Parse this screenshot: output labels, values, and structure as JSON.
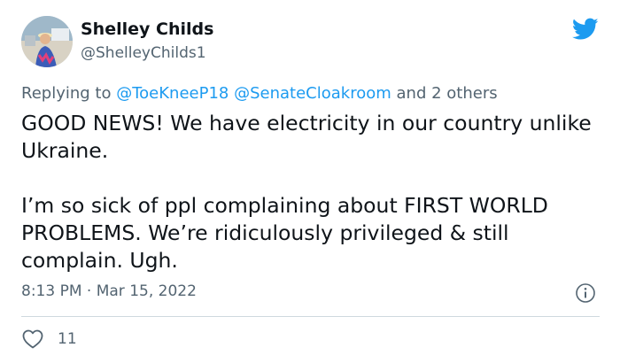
{
  "author": {
    "name": "Shelley Childs",
    "handle": "@ShelleyChilds1"
  },
  "reply": {
    "prefix": "Replying to",
    "mentions": [
      "@ToeKneeP18",
      "@SenateCloakroom"
    ],
    "suffix": "and 2 others"
  },
  "tweet": {
    "paragraphs": [
      "GOOD NEWS! We have electricity in our country unlike Ukraine.",
      "I’m so sick of ppl complaining about FIRST WORLD PROBLEMS. We’re ridiculously privileged & still complain. Ugh."
    ]
  },
  "meta": {
    "timestamp": "8:13 PM · Mar 15, 2022"
  },
  "stats": {
    "likes": "11"
  },
  "icons": {
    "brand": "twitter-bird-icon",
    "info": "info-icon",
    "like": "heart-icon"
  },
  "colors": {
    "brand": "#1d9bf0",
    "text": "#0f1419",
    "muted": "#536471",
    "divider": "#cfd9de"
  }
}
